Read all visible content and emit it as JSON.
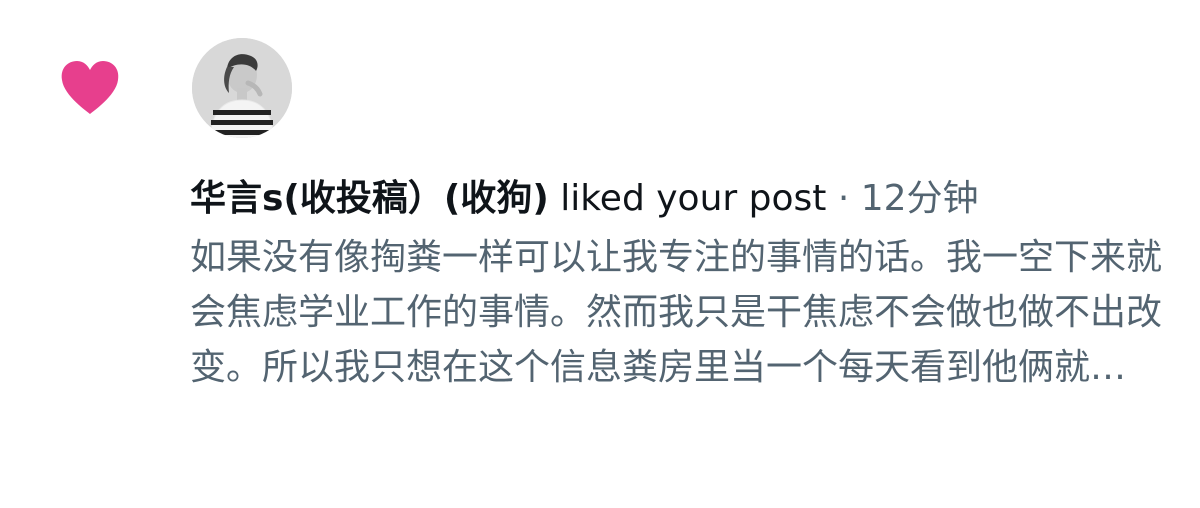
{
  "notification": {
    "type_icon": "heart-icon",
    "heart_color": "#e73f8d",
    "avatar_alt": "user avatar",
    "display_name": "华言s(收投稿）(收狗)",
    "action_text": " liked your post",
    "separator": " · ",
    "timestamp": "12分钟",
    "post_excerpt": "如果没有像掏粪一样可以让我专注的事情的话。我一空下来就会焦虑学业工作的事情。然而我只是干焦虑不会做也做不出改变。所以我只想在这个信息粪房里当一个每天看到他俩就…"
  },
  "colors": {
    "primary_text": "#0f1419",
    "secondary_text": "#536471",
    "background": "#ffffff"
  }
}
